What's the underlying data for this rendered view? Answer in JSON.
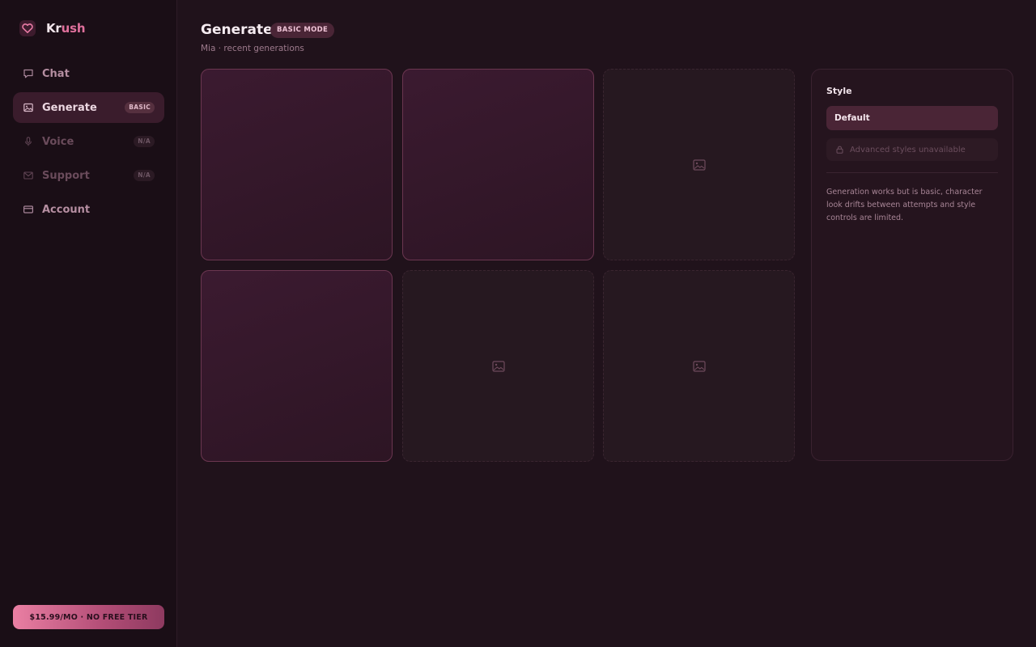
{
  "brand": {
    "name_part1": "Kr",
    "name_part2": "ush",
    "icon": "heart-icon",
    "accent": "#e0709c"
  },
  "sidebar": {
    "items": [
      {
        "label": "Chat",
        "icon": "chat-bubble-icon",
        "badge": "",
        "state": "normal"
      },
      {
        "label": "Generate",
        "icon": "image-icon",
        "badge": "BASIC",
        "state": "active"
      },
      {
        "label": "Voice",
        "icon": "microphone-icon",
        "badge": "N/A",
        "state": "disabled"
      },
      {
        "label": "Support",
        "icon": "mail-icon",
        "badge": "N/A",
        "state": "disabled"
      },
      {
        "label": "Account",
        "icon": "credit-card-icon",
        "badge": "",
        "state": "normal"
      }
    ],
    "tier_button": "$15.99/MO · NO FREE TIER"
  },
  "header": {
    "title": "Generate",
    "mode_badge": "BASIC MODE",
    "subtitle": "Mia · recent generations"
  },
  "gallery": {
    "tiles": [
      {
        "state": "filled"
      },
      {
        "state": "filled"
      },
      {
        "state": "empty",
        "icon": "image-placeholder-icon"
      },
      {
        "state": "filled"
      },
      {
        "state": "empty",
        "icon": "image-placeholder-icon"
      },
      {
        "state": "empty",
        "icon": "image-placeholder-icon"
      }
    ]
  },
  "style_panel": {
    "title": "Style",
    "selected": "Default",
    "locked_option": "Advanced styles unavailable",
    "locked_icon": "lock-icon",
    "note": "Generation works but is basic, character look drifts between attempts and style controls are limited."
  }
}
